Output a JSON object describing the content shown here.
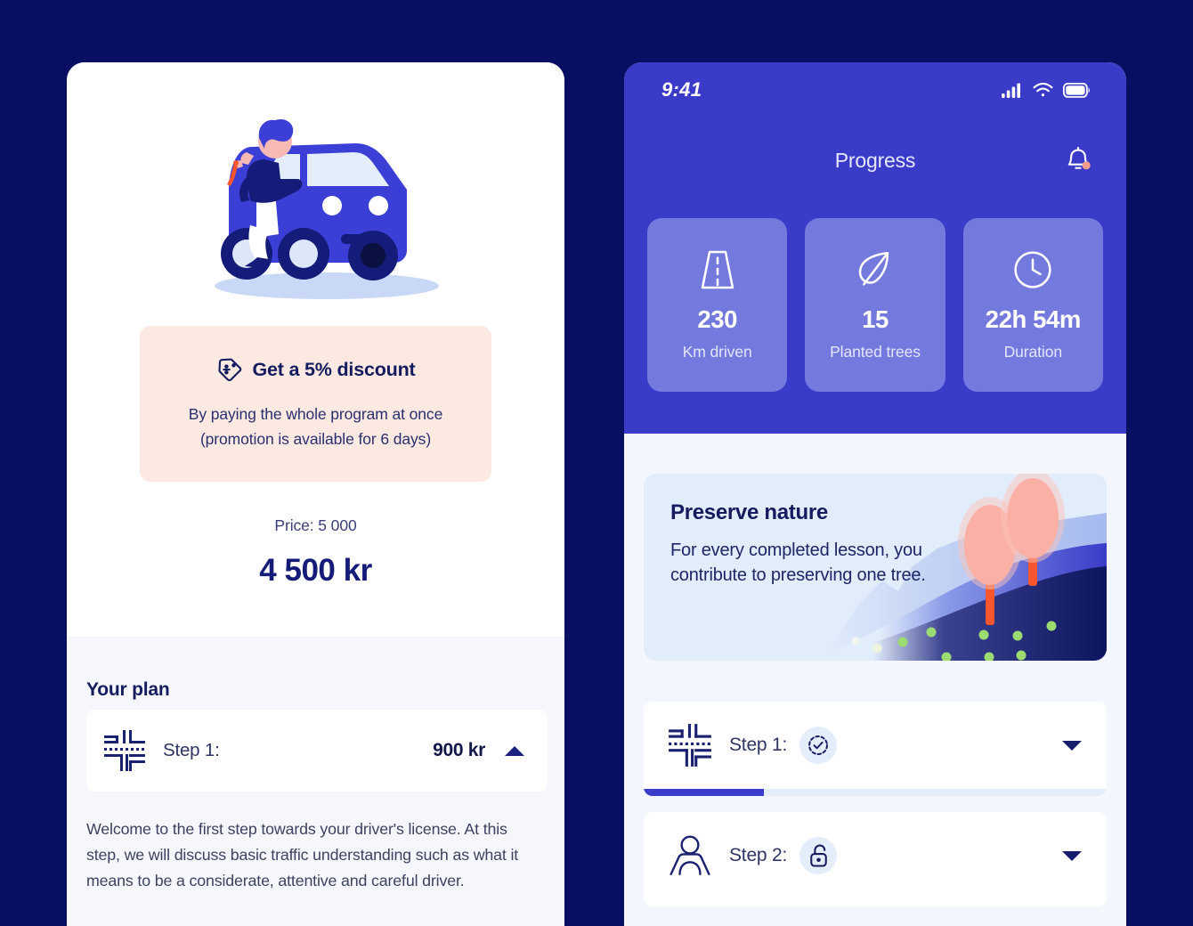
{
  "theme": {
    "page_bg": "#080F63",
    "accent_blue": "#3A3BC8",
    "stat_card_bg": "#7479DE",
    "navy_text": "#141B5E",
    "discount_bg": "#FCE9E1",
    "light_panel_bg": "#F5F7FD",
    "nature_card_bg": "#E2EDFB",
    "badge_bg": "#E4EDFA",
    "tree_pink": "#FAB0A4",
    "tree_trunk": "#F7562E",
    "dot_green": "#9BDB72"
  },
  "left_panel": {
    "illustration": {
      "name": "person-leaning-on-car-illustration",
      "alt": "Person with keys leaning on a blue car"
    },
    "discount": {
      "icon": "price-tag-percent-icon",
      "title": "Get a 5% discount",
      "subtitle_line1": "By paying the whole program at once",
      "subtitle_line2": "(promotion is available for 6 days)"
    },
    "price": {
      "old_label": "Price: 5 000",
      "new_label": "4 500 kr"
    },
    "plan": {
      "heading": "Your plan",
      "step": {
        "icon": "crossroad-intersection-icon",
        "label": "Step 1:",
        "price": "900 kr",
        "toggle_icon": "chevron-up-icon",
        "expanded": true,
        "description": "Welcome to the first step towards your driver's license. At this step, we will discuss basic traffic understanding such as what it means to be a considerate, attentive and careful driver."
      }
    }
  },
  "right_panel": {
    "status_bar": {
      "time": "9:41",
      "icons": [
        "cellular-signal-icon",
        "wifi-icon",
        "battery-icon"
      ]
    },
    "nav": {
      "title": "Progress",
      "bell_icon": "notification-bell-icon",
      "has_unread_dot": true
    },
    "stats": [
      {
        "icon": "road-icon",
        "value": "230",
        "label": "Km driven"
      },
      {
        "icon": "leaf-icon",
        "value": "15",
        "label": "Planted trees"
      },
      {
        "icon": "clock-icon",
        "value": "22h 54m",
        "label": "Duration"
      }
    ],
    "nature_card": {
      "title": "Preserve nature",
      "body": "For every completed lesson, you contribute to preserving one tree.",
      "art": "hills-with-two-trees-illustration"
    },
    "steps": [
      {
        "icon": "crossroad-intersection-icon",
        "label": "Step 1:",
        "badge_icon": "check-circle-dashed-icon",
        "toggle_icon": "chevron-down-icon",
        "progress_percent": 26
      },
      {
        "icon": "person-icon",
        "label": "Step 2:",
        "badge_icon": "unlocked-padlock-icon",
        "toggle_icon": "chevron-down-icon",
        "progress_percent": 0
      }
    ]
  }
}
